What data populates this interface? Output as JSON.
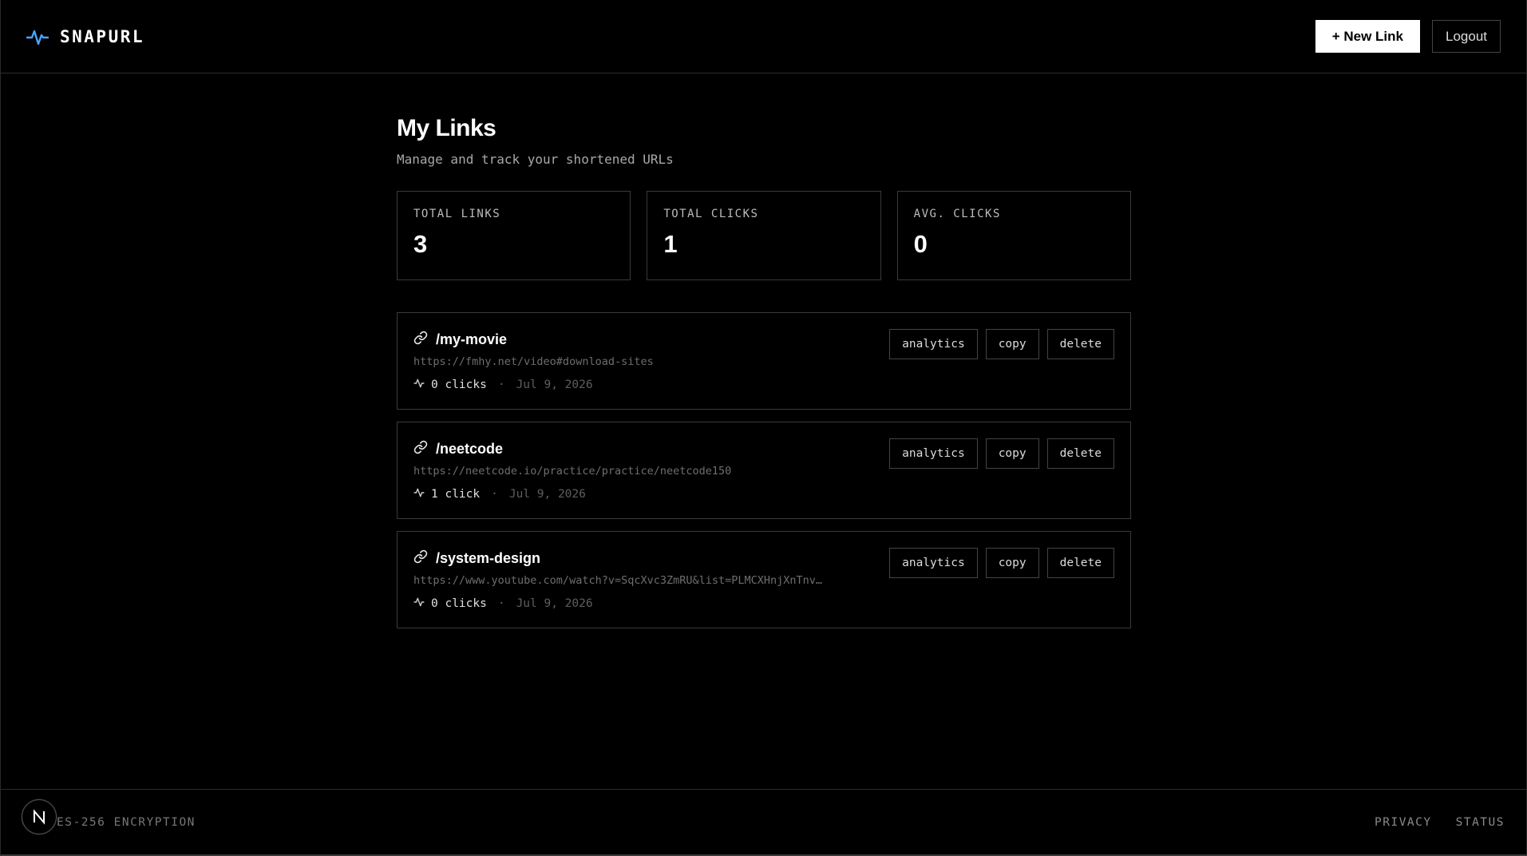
{
  "brand": {
    "name": "SNAPURL",
    "icon": "pulse-icon",
    "accent": "#4aa3ff"
  },
  "header": {
    "new_link_label": "+ New Link",
    "logout_label": "Logout"
  },
  "page": {
    "title": "My Links",
    "subtitle": "Manage and track your shortened URLs"
  },
  "stats": [
    {
      "label": "TOTAL LINKS",
      "value": "3"
    },
    {
      "label": "TOTAL CLICKS",
      "value": "1"
    },
    {
      "label": "AVG. CLICKS",
      "value": "0"
    }
  ],
  "actions": {
    "analytics": "analytics",
    "copy": "copy",
    "delete": "delete"
  },
  "links": [
    {
      "slug": "/my-movie",
      "url": "https://fmhy.net/video#download-sites",
      "clicks": "0 clicks",
      "date": "Jul 9, 2026"
    },
    {
      "slug": "/neetcode",
      "url": "https://neetcode.io/practice/practice/neetcode150",
      "clicks": "1 click",
      "date": "Jul 9, 2026"
    },
    {
      "slug": "/system-design",
      "url": "https://www.youtube.com/watch?v=SqcXvc3ZmRU&list=PLMCXHnjXnTnv…",
      "clicks": "0 clicks",
      "date": "Jul 9, 2026"
    }
  ],
  "footer": {
    "encryption": "ES-256 ENCRYPTION",
    "privacy": "PRIVACY",
    "status": "STATUS"
  },
  "dev_badge": {
    "letter": "N"
  }
}
